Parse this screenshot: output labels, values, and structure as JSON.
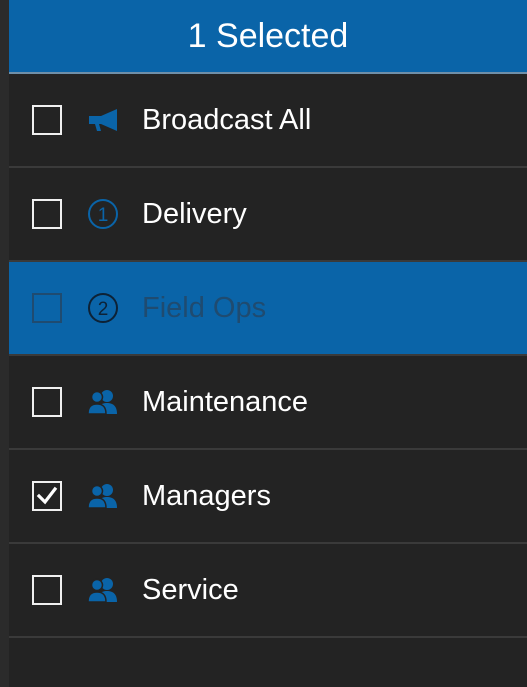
{
  "header": {
    "title": "1 Selected"
  },
  "colors": {
    "accent": "#0a64a8",
    "background": "#232323"
  },
  "items": [
    {
      "label": "Broadcast All",
      "icon": "megaphone-icon",
      "checked": false,
      "highlighted": false
    },
    {
      "label": "Delivery",
      "icon": "circled-number-1-icon",
      "checked": false,
      "highlighted": false
    },
    {
      "label": "Field Ops",
      "icon": "circled-number-2-icon",
      "checked": false,
      "highlighted": true
    },
    {
      "label": "Maintenance",
      "icon": "group-icon",
      "checked": false,
      "highlighted": false
    },
    {
      "label": "Managers",
      "icon": "group-icon",
      "checked": true,
      "highlighted": false
    },
    {
      "label": "Service",
      "icon": "group-icon",
      "checked": false,
      "highlighted": false
    }
  ]
}
